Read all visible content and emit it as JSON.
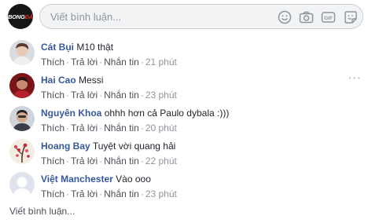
{
  "composer": {
    "page_logo": {
      "prefix": "BONG",
      "accent": "ĐÁ"
    },
    "placeholder": "Viết bình luận...",
    "icons": [
      "emoji-icon",
      "camera-icon",
      "gif-icon",
      "sticker-icon"
    ],
    "gif_label": "GIF"
  },
  "comments": [
    {
      "author": "Cát Bụi",
      "text": "M10 thật",
      "like": "Thích",
      "reply": "Trả lời",
      "message": "Nhắn tin",
      "time": "21 phút"
    },
    {
      "author": "Hai Cao",
      "text": "Messi",
      "like": "Thích",
      "reply": "Trả lời",
      "message": "Nhắn tin",
      "time": "23 phút"
    },
    {
      "author": "Nguyên Khoa",
      "text": "ohhh hơn cả Paulo dybala :)))",
      "like": "Thích",
      "reply": "Trả lời",
      "message": "Nhắn tin",
      "time": "20 phút"
    },
    {
      "author": "Hoang Bay",
      "text": "Tuyệt vời quang hải",
      "like": "Thích",
      "reply": "Trả lời",
      "message": "Nhắn tin",
      "time": "22 phút"
    },
    {
      "author": "Việt Manchester",
      "text": "Vào ooo",
      "like": "Thích",
      "reply": "Trả lời",
      "message": "Nhắn tin",
      "time": "23 phút"
    }
  ],
  "separator": "·",
  "more_menu": "···",
  "footer": {
    "write_comment": "Viết bình luận..."
  },
  "colors": {
    "author": "#385898",
    "muted": "#90949c",
    "input_bg": "#f2f3f5",
    "input_border": "#ccd0d5"
  }
}
